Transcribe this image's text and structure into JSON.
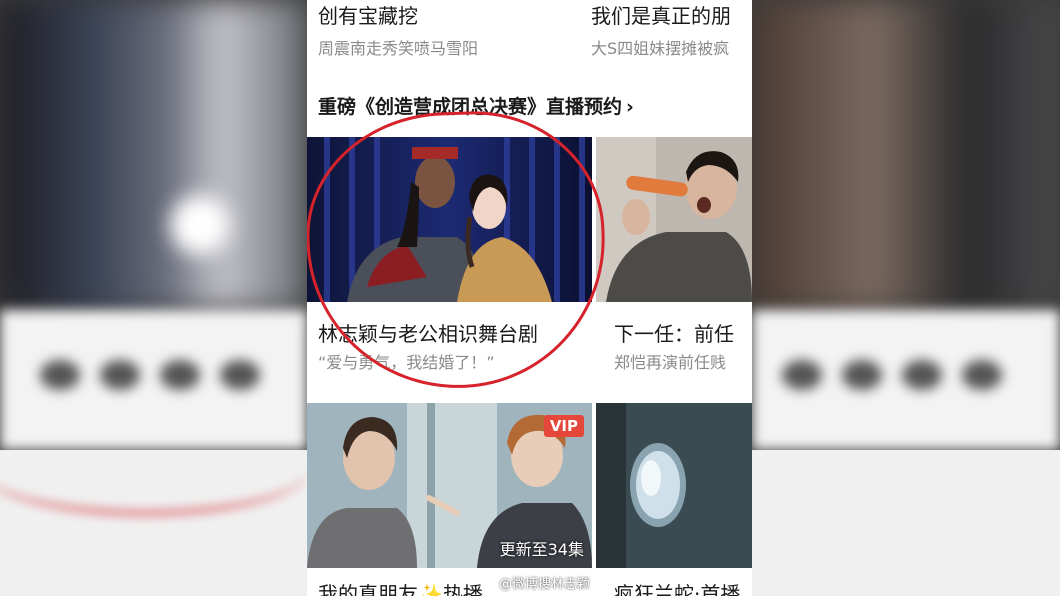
{
  "feed": {
    "top": {
      "left": {
        "title": "创有宝藏挖",
        "sub": "周震南走秀笑喷马雪阳"
      },
      "right": {
        "title": "我们是真正的朋",
        "sub": "大S四姐妹摆摊被疯"
      }
    },
    "section": {
      "label": "重磅《创造营成团总决赛》直播预约",
      "chevron": "›"
    },
    "cards": [
      {
        "title": "林志颖与老公相识舞台剧",
        "sub": "“爱与勇气，我结婚了！”"
      },
      {
        "title": "下一任：前任",
        "sub": "郑恺再演前任贱"
      }
    ],
    "bottom_cards": [
      {
        "badge": "VIP",
        "episode": "更新至34集",
        "title": "我的真朋友✨热播"
      },
      {
        "title": "疯狂兰蛇·首播"
      }
    ],
    "watermark": "@微博搜林志颖"
  },
  "colors": {
    "accent": "#d6232b",
    "vip": "#e6473b"
  }
}
